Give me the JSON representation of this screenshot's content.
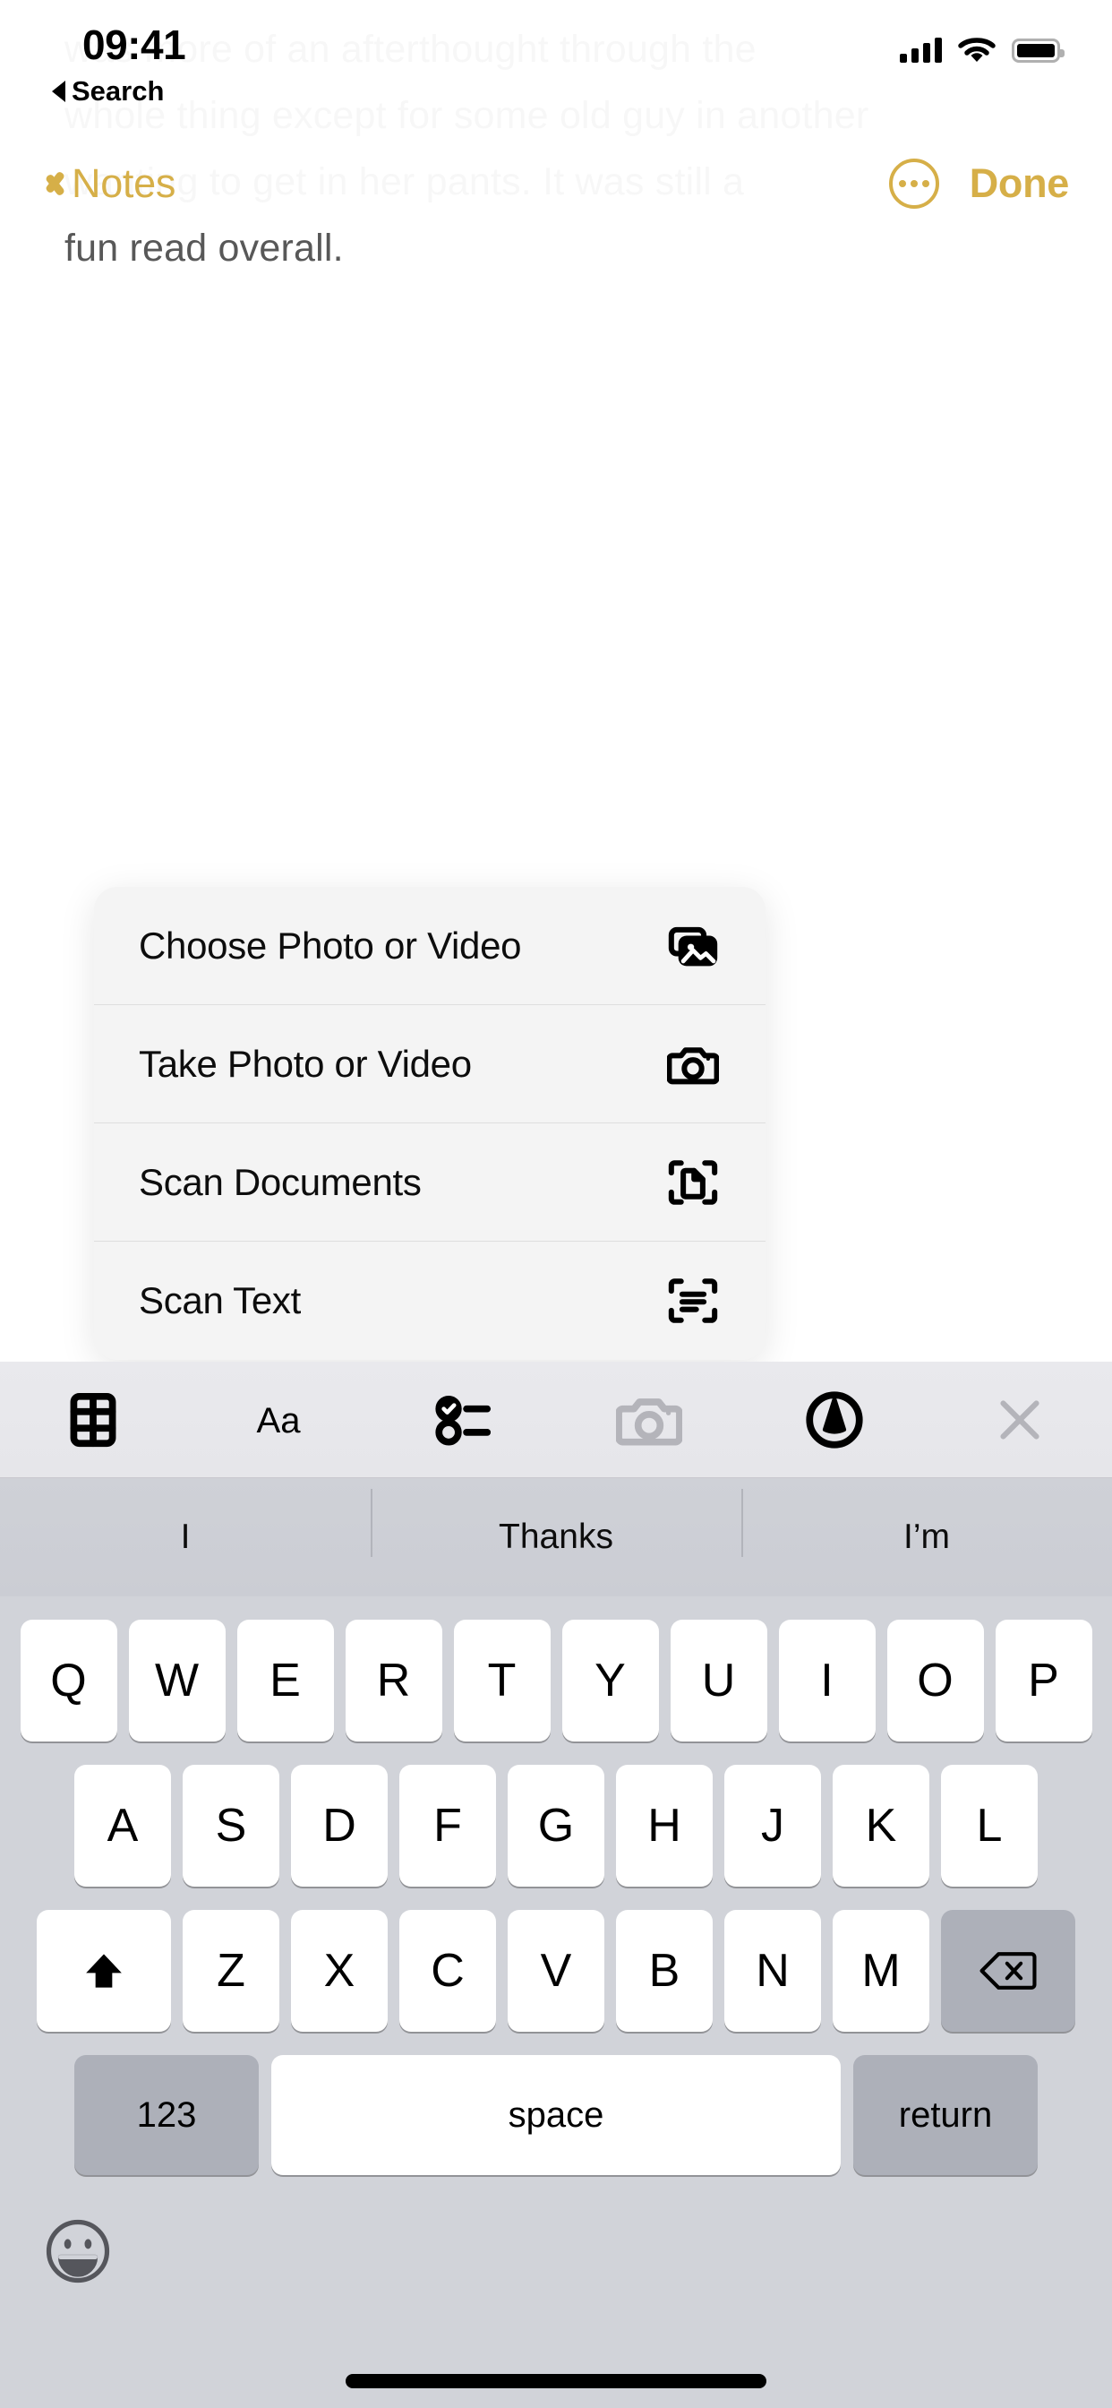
{
  "status_bar": {
    "time": "09:41",
    "back_app_label": "Search",
    "signal_icon": "cellular-bars-icon",
    "wifi_icon": "wifi-icon",
    "battery_icon": "battery-full-icon"
  },
  "nav_bar": {
    "back_label": "Notes",
    "more_icon": "more-ellipsis-circle-icon",
    "done_label": "Done",
    "accent_color": "#d6af48"
  },
  "note_body": {
    "line1": "was more of an afterthought through the",
    "line2": "whole thing except for some old guy in another",
    "line3": "wanting to get in her pants. It was still a",
    "line4": "fun read overall."
  },
  "action_menu": {
    "items": [
      {
        "label": "Choose Photo or Video",
        "icon": "photo-library-icon"
      },
      {
        "label": "Take Photo or Video",
        "icon": "camera-icon"
      },
      {
        "label": "Scan Documents",
        "icon": "document-scan-icon"
      },
      {
        "label": "Scan Text",
        "icon": "text-scan-icon"
      }
    ]
  },
  "edit_toolbar": {
    "items": [
      {
        "name": "table-icon",
        "label": "Table",
        "enabled": true
      },
      {
        "name": "format-aa-icon",
        "label": "Aa",
        "enabled": true
      },
      {
        "name": "checklist-icon",
        "label": "Checklist",
        "enabled": true
      },
      {
        "name": "camera-icon",
        "label": "Camera",
        "enabled": false
      },
      {
        "name": "markup-pen-icon",
        "label": "Markup",
        "enabled": true
      },
      {
        "name": "close-x-icon",
        "label": "Close",
        "enabled": false
      }
    ]
  },
  "keyboard": {
    "suggestions": [
      "I",
      "Thanks",
      "I’m"
    ],
    "row1": [
      "Q",
      "W",
      "E",
      "R",
      "T",
      "Y",
      "U",
      "I",
      "O",
      "P"
    ],
    "row2": [
      "A",
      "S",
      "D",
      "F",
      "G",
      "H",
      "J",
      "K",
      "L"
    ],
    "row3": [
      "Z",
      "X",
      "C",
      "V",
      "B",
      "N",
      "M"
    ],
    "shift_icon": "shift-arrow-icon",
    "backspace_icon": "backspace-icon",
    "numbers_label": "123",
    "space_label": "space",
    "return_label": "return",
    "emoji_icon": "emoji-smiley-icon"
  }
}
